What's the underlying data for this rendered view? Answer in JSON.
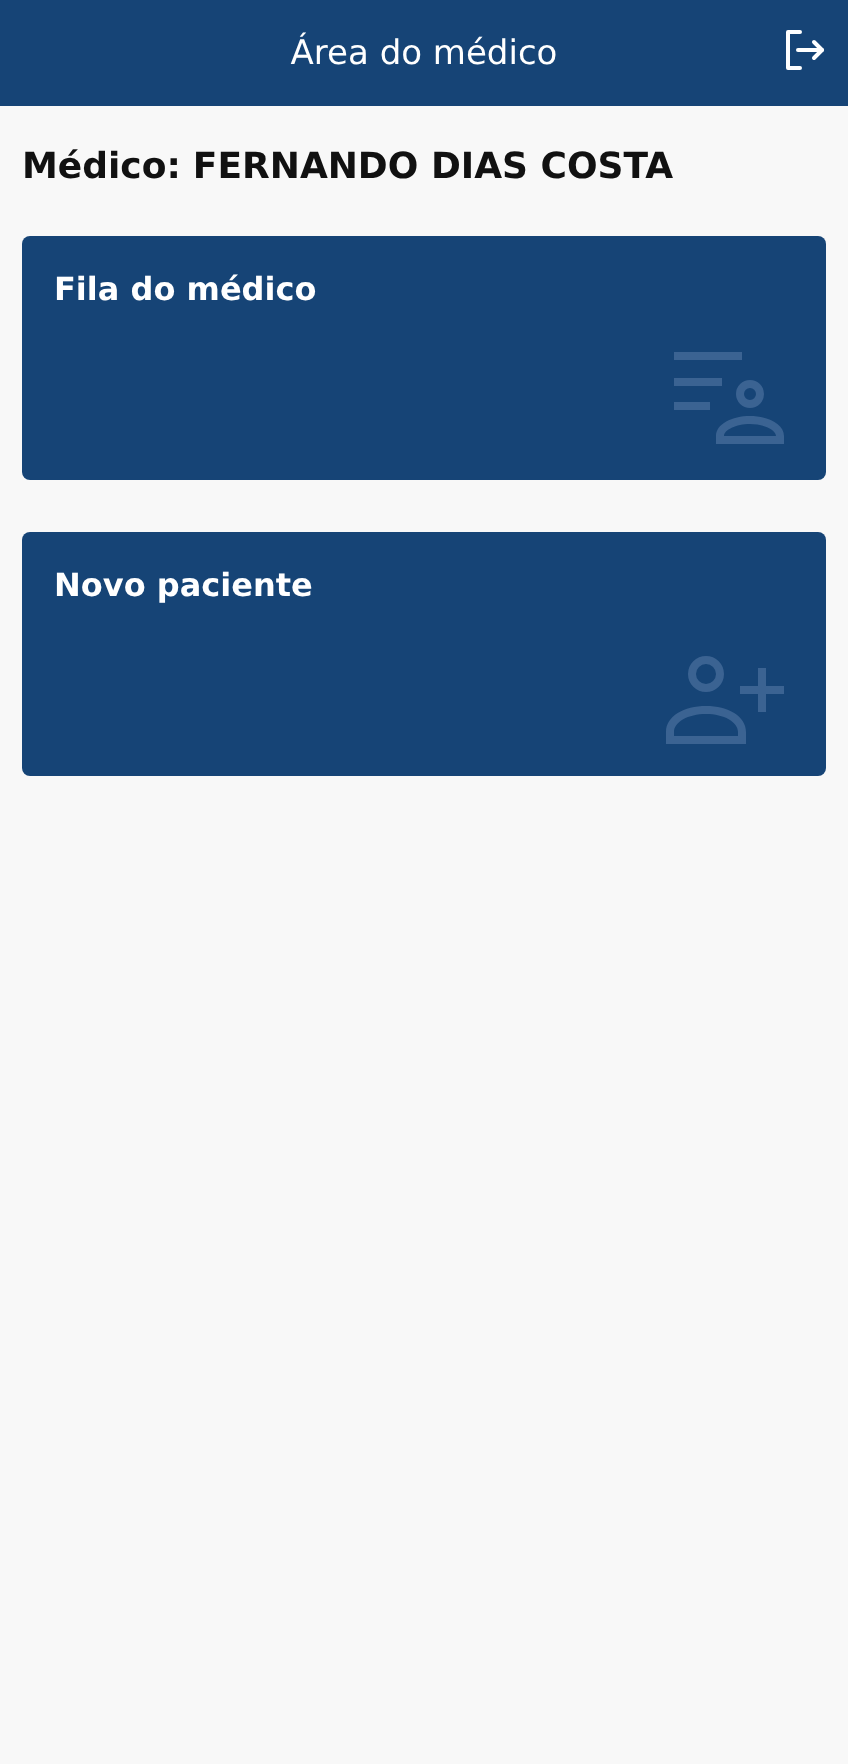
{
  "header": {
    "title": "Área do médico"
  },
  "doctor": {
    "label": "Médico:",
    "name": "FERNANDO DIAS COSTA"
  },
  "cards": [
    {
      "title": "Fila do médico",
      "kind": "queue"
    },
    {
      "title": "Novo paciente",
      "kind": "add-person"
    }
  ]
}
